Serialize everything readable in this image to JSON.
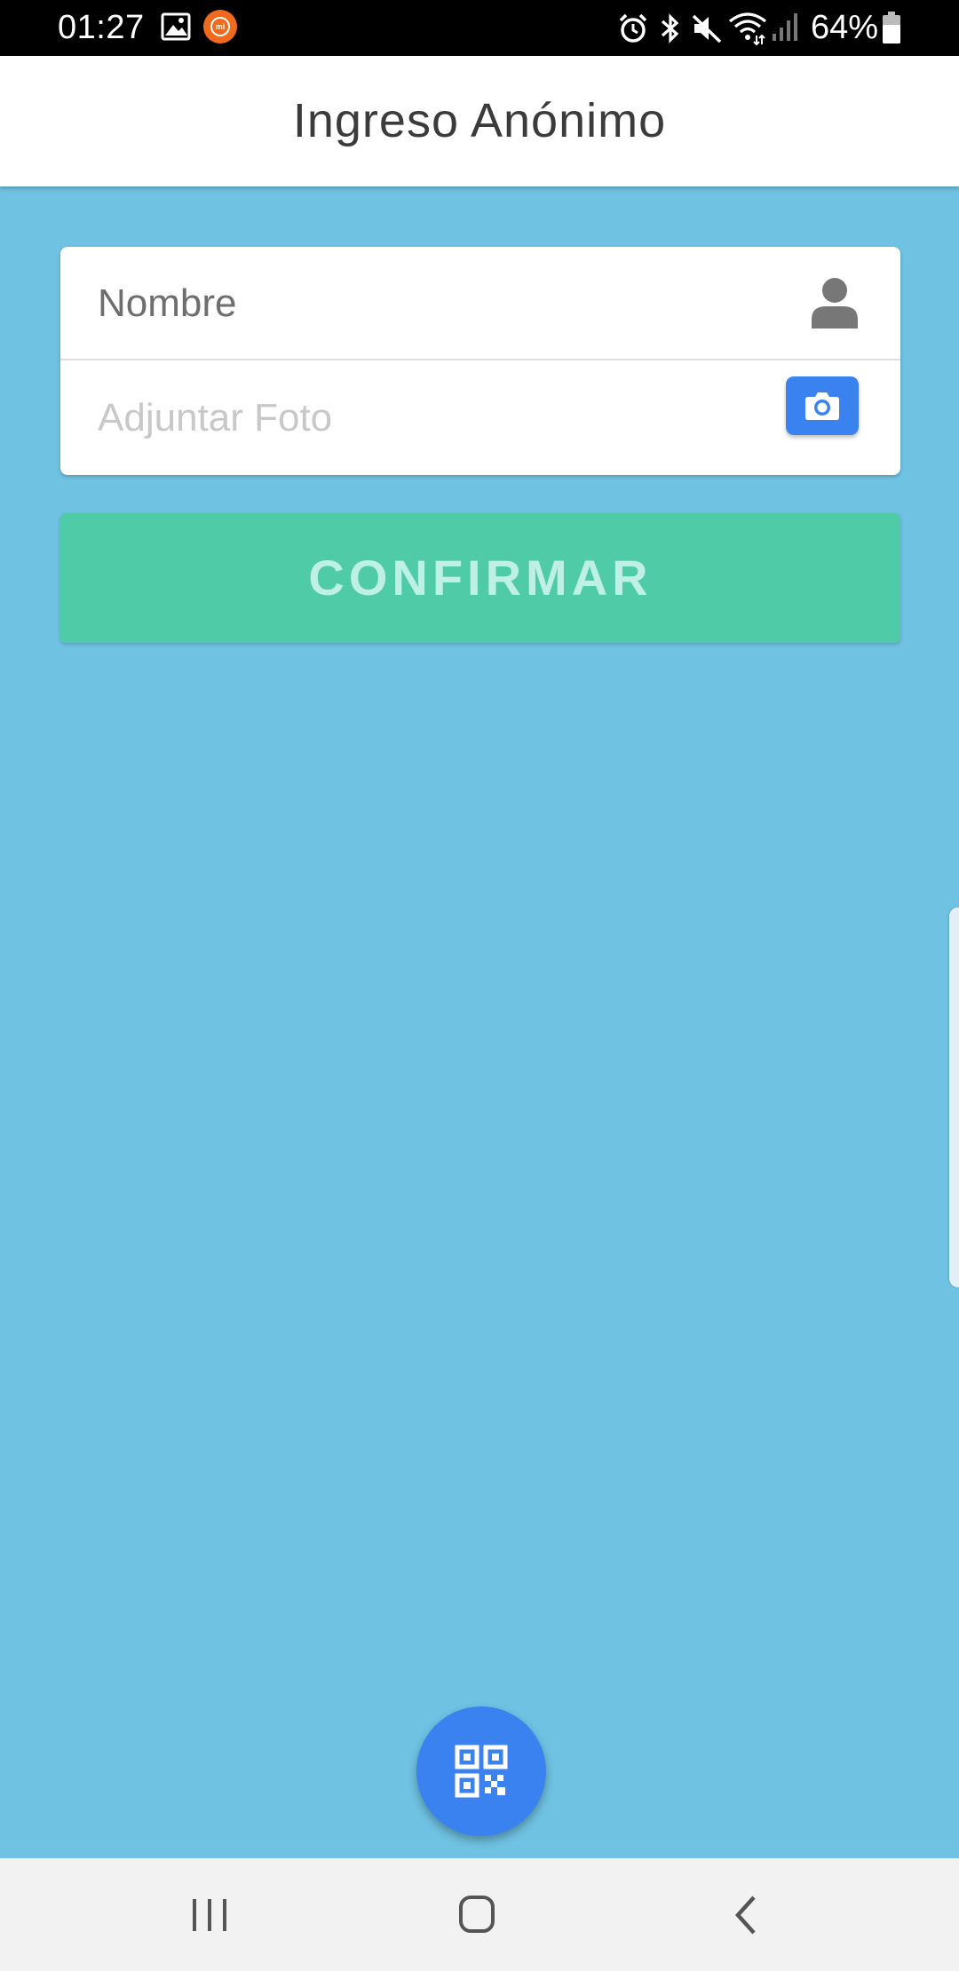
{
  "status_bar": {
    "time": "01:27",
    "battery": "64%",
    "icons": [
      "gallery-icon",
      "mi-app-icon",
      "alarm-icon",
      "bluetooth-icon",
      "mute-icon",
      "wifi-icon",
      "signal-icon",
      "battery-icon"
    ]
  },
  "header": {
    "title": "Ingreso Anónimo"
  },
  "form": {
    "name_placeholder": "Nombre",
    "name_value": "",
    "photo_label": "Adjuntar Foto"
  },
  "confirm": {
    "label": "CONFIRMAR"
  },
  "fab": {
    "icon": "qr-code-icon"
  },
  "nav": {
    "items": [
      "recents",
      "home",
      "back"
    ]
  },
  "colors": {
    "background": "#6fc2e2",
    "header": "#ffffff",
    "accent": "#3b82f1",
    "confirm": "#4fcba8",
    "confirm_text": "#bff0e6"
  }
}
